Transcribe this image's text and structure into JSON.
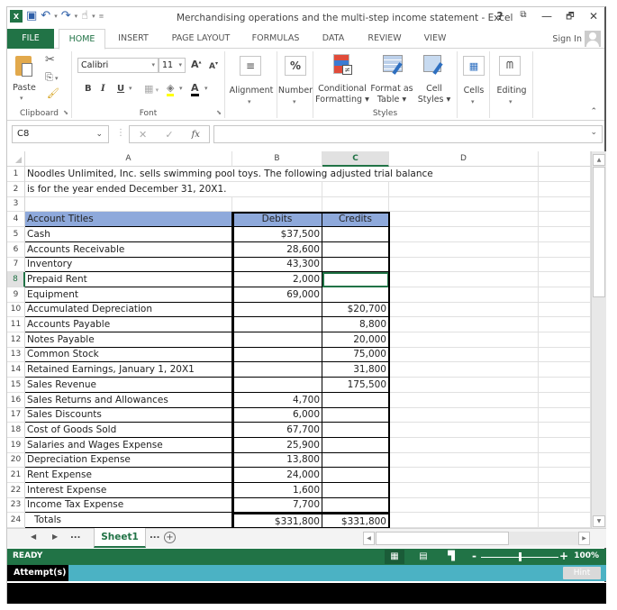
{
  "app": {
    "title": "Merchandising operations and the multi-step income statement - Excel",
    "window_controls": {
      "help": "?",
      "ribbon_display": "⧉",
      "minimize": "—",
      "restore": "🗗",
      "close": "✕"
    },
    "sign_in": "Sign In"
  },
  "tabs": [
    {
      "label": "FILE"
    },
    {
      "label": "HOME",
      "active": true
    },
    {
      "label": "INSERT"
    },
    {
      "label": "PAGE LAYOUT"
    },
    {
      "label": "FORMULAS"
    },
    {
      "label": "DATA"
    },
    {
      "label": "REVIEW"
    },
    {
      "label": "VIEW"
    }
  ],
  "ribbon": {
    "clipboard": {
      "label": "Clipboard",
      "paste": "Paste"
    },
    "font": {
      "label": "Font",
      "font_name": "Calibri",
      "font_size": "11",
      "bold": "B",
      "italic": "I",
      "underline": "U"
    },
    "alignment": {
      "label": "Alignment"
    },
    "number": {
      "label": "Number",
      "icon_text": "%"
    },
    "styles": {
      "label": "Styles",
      "conditional_formatting": [
        "Conditional",
        "Formatting ▾"
      ],
      "format_as_table": [
        "Format as",
        "Table ▾"
      ],
      "cell_styles": [
        "Cell",
        "Styles ▾"
      ]
    },
    "cells": {
      "label": "Cells"
    },
    "editing": {
      "label": "Editing"
    }
  },
  "formula_bar": {
    "name_box": "C8",
    "formula": ""
  },
  "grid": {
    "columns": [
      "A",
      "B",
      "C",
      "D"
    ],
    "selected_column": "C",
    "selected_row": 8,
    "row_numbers": [
      1,
      2,
      3,
      4,
      5,
      6,
      7,
      8,
      9,
      10,
      11,
      12,
      13,
      14,
      15,
      16,
      17,
      18,
      19,
      20,
      21,
      22,
      23,
      24
    ],
    "intro_line_1": "Noodles Unlimited, Inc. sells swimming pool toys.  The following adjusted trial balance",
    "intro_line_2": "is for the year ended December 31, 20X1.",
    "table_header": {
      "account": "Account Titles",
      "debits": "Debits",
      "credits": "Credits"
    },
    "rows": [
      {
        "row": 5,
        "account": "Cash",
        "debit": "$37,500",
        "credit": ""
      },
      {
        "row": 6,
        "account": "Accounts Receivable",
        "debit": "28,600",
        "credit": ""
      },
      {
        "row": 7,
        "account": "Inventory",
        "debit": "43,300",
        "credit": ""
      },
      {
        "row": 8,
        "account": "Prepaid Rent",
        "debit": "2,000",
        "credit": ""
      },
      {
        "row": 9,
        "account": "Equipment",
        "debit": "69,000",
        "credit": ""
      },
      {
        "row": 10,
        "account": "Accumulated Depreciation",
        "debit": "",
        "credit": "$20,700"
      },
      {
        "row": 11,
        "account": "Accounts Payable",
        "debit": "",
        "credit": "8,800"
      },
      {
        "row": 12,
        "account": "Notes Payable",
        "debit": "",
        "credit": "20,000"
      },
      {
        "row": 13,
        "account": "Common Stock",
        "debit": "",
        "credit": "75,000"
      },
      {
        "row": 14,
        "account": "Retained Earnings, January 1, 20X1",
        "debit": "",
        "credit": "31,800"
      },
      {
        "row": 15,
        "account": "Sales Revenue",
        "debit": "",
        "credit": "175,500"
      },
      {
        "row": 16,
        "account": "Sales Returns and Allowances",
        "debit": "4,700",
        "credit": ""
      },
      {
        "row": 17,
        "account": "Sales Discounts",
        "debit": "6,000",
        "credit": ""
      },
      {
        "row": 18,
        "account": "Cost of Goods Sold",
        "debit": "67,700",
        "credit": ""
      },
      {
        "row": 19,
        "account": "Salaries and Wages Expense",
        "debit": "25,900",
        "credit": ""
      },
      {
        "row": 20,
        "account": "Depreciation Expense",
        "debit": "13,800",
        "credit": ""
      },
      {
        "row": 21,
        "account": "Rent Expense",
        "debit": "24,000",
        "credit": ""
      },
      {
        "row": 22,
        "account": "Interest Expense",
        "debit": "1,600",
        "credit": ""
      },
      {
        "row": 23,
        "account": "Income Tax Expense",
        "debit": "7,700",
        "credit": ""
      }
    ],
    "totals": {
      "label": "Totals",
      "debit": "$331,800",
      "credit": "$331,800"
    }
  },
  "sheets": {
    "ellipsis": "...",
    "active": "Sheet1",
    "add": "+"
  },
  "status": {
    "text": "READY",
    "zoom": "100%",
    "zoom_percent": 100
  },
  "attempt": {
    "label": "Attempt(s)",
    "hint": "Hint"
  }
}
